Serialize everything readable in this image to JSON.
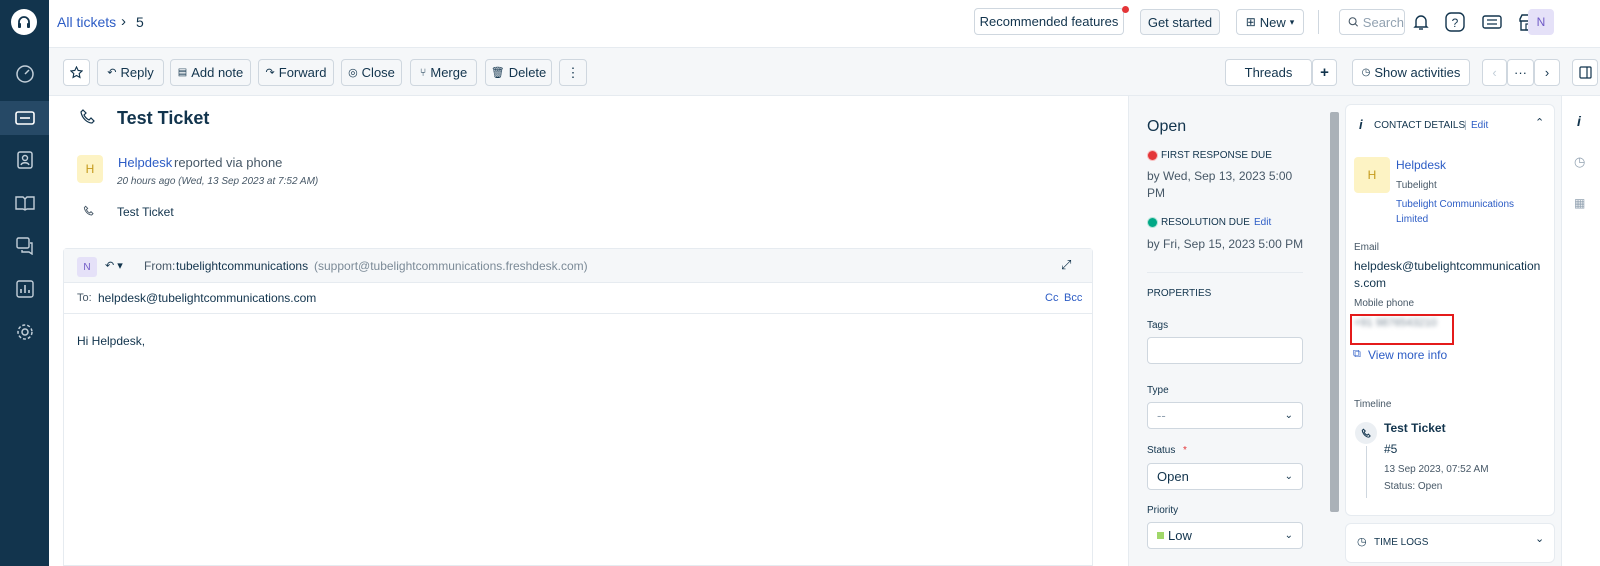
{
  "breadcrumb": {
    "all_tickets": "All tickets",
    "sep": "›",
    "ticket_id": "5"
  },
  "header": {
    "recommended_features": "Recommended features",
    "get_started": "Get started",
    "new_label": "New",
    "search_placeholder": "Search",
    "avatar_initial": "N"
  },
  "toolbar": {
    "reply": "Reply",
    "add_note": "Add note",
    "forward": "Forward",
    "close": "Close",
    "merge": "Merge",
    "delete": "Delete",
    "more": "⋮",
    "threads": "Threads",
    "plus": "+",
    "show_activities": "Show activities",
    "prev": "‹",
    "ellipsis": "···",
    "next": "›"
  },
  "ticket": {
    "title": "Test Ticket",
    "requester_name": "Helpdesk",
    "requester_initial": "H",
    "reported_via": "reported via phone",
    "time_ago": "20 hours ago (Wed, 13 Sep 2023 at 7:52 AM)",
    "description": "Test Ticket"
  },
  "reply_box": {
    "avatar_initial": "N",
    "from_label": "From:",
    "from_name": "tubelightcommunications",
    "from_email": "(support@tubelightcommunications.freshdesk.com)",
    "to_label": "To:",
    "to_email": "helpdesk@tubelightcommunications.com",
    "cc": "Cc",
    "bcc": "Bcc",
    "body": "Hi Helpdesk,"
  },
  "properties": {
    "status_heading": "Open",
    "first_response_label": "FIRST RESPONSE DUE",
    "first_response_value": "by Wed, Sep 13, 2023 5:00 PM",
    "first_response_color": "#e43538",
    "resolution_label": "RESOLUTION DUE",
    "resolution_edit": "Edit",
    "resolution_value": "by Fri, Sep 15, 2023 5:00 PM",
    "resolution_color": "#00a886",
    "section_title": "PROPERTIES",
    "tags_label": "Tags",
    "type_label": "Type",
    "type_value": "--",
    "status_label": "Status",
    "required_mark": "*",
    "status_value": "Open",
    "priority_label": "Priority",
    "priority_value": "Low",
    "priority_color": "#a0d76a"
  },
  "contact": {
    "header": "CONTACT DETAILS",
    "edit": "Edit",
    "name": "Helpdesk",
    "initial": "H",
    "company_short": "Tubelight",
    "company_full_line1": "Tubelight Communications",
    "company_full_line2": "Limited",
    "email_label": "Email",
    "email_line1": "helpdesk@tubelightcommunication",
    "email_line2": "s.com",
    "mobile_label": "Mobile phone",
    "mobile_value": "+91 9876543210",
    "view_more": "View more info",
    "timeline_label": "Timeline",
    "timeline_title": "Test Ticket",
    "timeline_id": "#5",
    "timeline_date": "13 Sep 2023, 07:52 AM",
    "timeline_status": "Status: Open",
    "time_logs": "TIME LOGS"
  }
}
